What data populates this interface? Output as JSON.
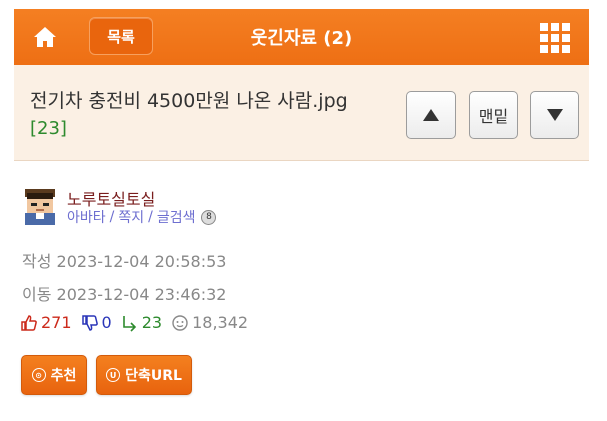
{
  "header": {
    "home_icon": "home-icon",
    "list_label": "목록",
    "board_title": "웃긴자료 (2)",
    "menu_icon": "grid-menu-icon",
    "accent_color": "#f0731a"
  },
  "post": {
    "title": "전기차 충전비 4500만원 나온 사람.jpg",
    "comment_count": "[23]"
  },
  "nav": {
    "up_icon": "arrow-up-icon",
    "bottom_label": "맨밑",
    "down_icon": "arrow-down-icon"
  },
  "author": {
    "name": "노루토실토실",
    "links": [
      "아바타",
      "쪽지",
      "글검색"
    ],
    "separator": "/",
    "level": "8"
  },
  "meta": {
    "written": "작성 2023-12-04 20:58:53",
    "moved": "이동 2023-12-04 23:46:32"
  },
  "stats": {
    "likes": "271",
    "dislikes": "0",
    "comments": "23",
    "views": "18,342"
  },
  "actions": {
    "recommend_label": "추천",
    "shorturl_label": "단축URL",
    "recommend_icon_letter": "⊙",
    "shorturl_icon_letter": "U"
  }
}
